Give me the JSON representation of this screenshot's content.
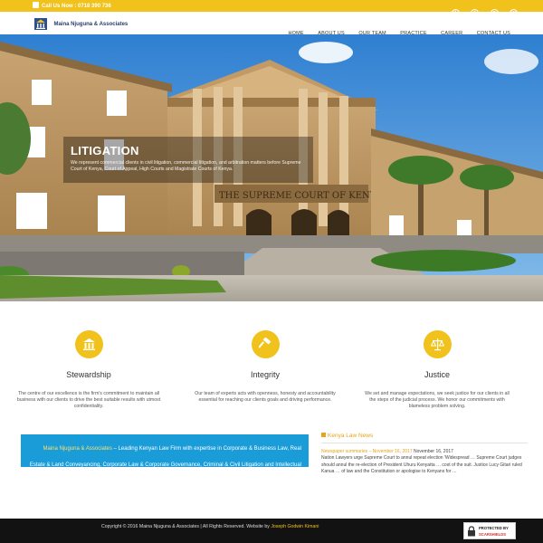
{
  "topbar": {
    "call_text": "Call Us Now : 0718 390 736"
  },
  "social_icons": [
    "facebook-icon",
    "twitter-icon",
    "google-plus-icon",
    "linkedin-icon"
  ],
  "brand": {
    "name": "Maina Njuguna & Associates"
  },
  "nav": {
    "items": [
      "HOME",
      "ABOUT US",
      "OUR TEAM",
      "PRACTICE",
      "CAREER",
      "CONTACT US"
    ]
  },
  "hero": {
    "title": "LITIGATION",
    "text": "We represent commercial clients in civil litigation, commercial litigation, and arbitration matters before Supreme Court of Kenya, Court of Appeal, High Courts and Magistrate Courts of Kenya.",
    "building_sign": "THE SUPREME COURT OF KENYA"
  },
  "features": [
    {
      "icon": "bank-icon",
      "title": "Stewardship",
      "text": "The centre of our excellence is the firm's commitment to maintain all business with our clients to drive the best suitable results with utmost confidentiality."
    },
    {
      "icon": "gavel-icon",
      "title": "Integrity",
      "text": "Our team of experts acts with openness, honesty and accountability essential for reaching our clients goals and driving performance."
    },
    {
      "icon": "scales-icon",
      "title": "Justice",
      "text": "We set and manage expectations, we seek justice for our clients in all the steps of the judicial process. We honor our commitments with blameless problem solving."
    }
  ],
  "intro": {
    "link": "Maina Njuguna & Associates",
    "text": " – Leading Kenyan Law Firm with expertise in Corporate & Business Law, Real Estate & Land Conveyancing, Corporate Law & Corporate Governance, Criminal & Civil Litigation and Intellectual Property Law."
  },
  "news": {
    "heading": "Kenya Law News",
    "items": [
      {
        "title": "Newspaper summaries – November 16, 2017",
        "date": " November 16, 2017",
        "text": "Nation Lawyers urge Supreme Court to annul repeat election 'Widespread … Supreme Court judges should annul the re-election of President Uhuru Kenyatta … cost of the suit. Justice Lucy Gitari ruled Kanua … of law and the Constitution or apologise to Kenyans for …"
      }
    ]
  },
  "footer": {
    "copyright": "Copyright © 2016 Maina Njuguna & Associates | All Rights Reserved. Website by ",
    "author": "Joseph Godwin Kimani",
    "badge_line1": "PROTECTED BY",
    "badge_line2": "SCARSHIELDS"
  },
  "colors": {
    "accent": "#f0c21b",
    "blue": "#1a9cd8",
    "footer": "#121212"
  }
}
